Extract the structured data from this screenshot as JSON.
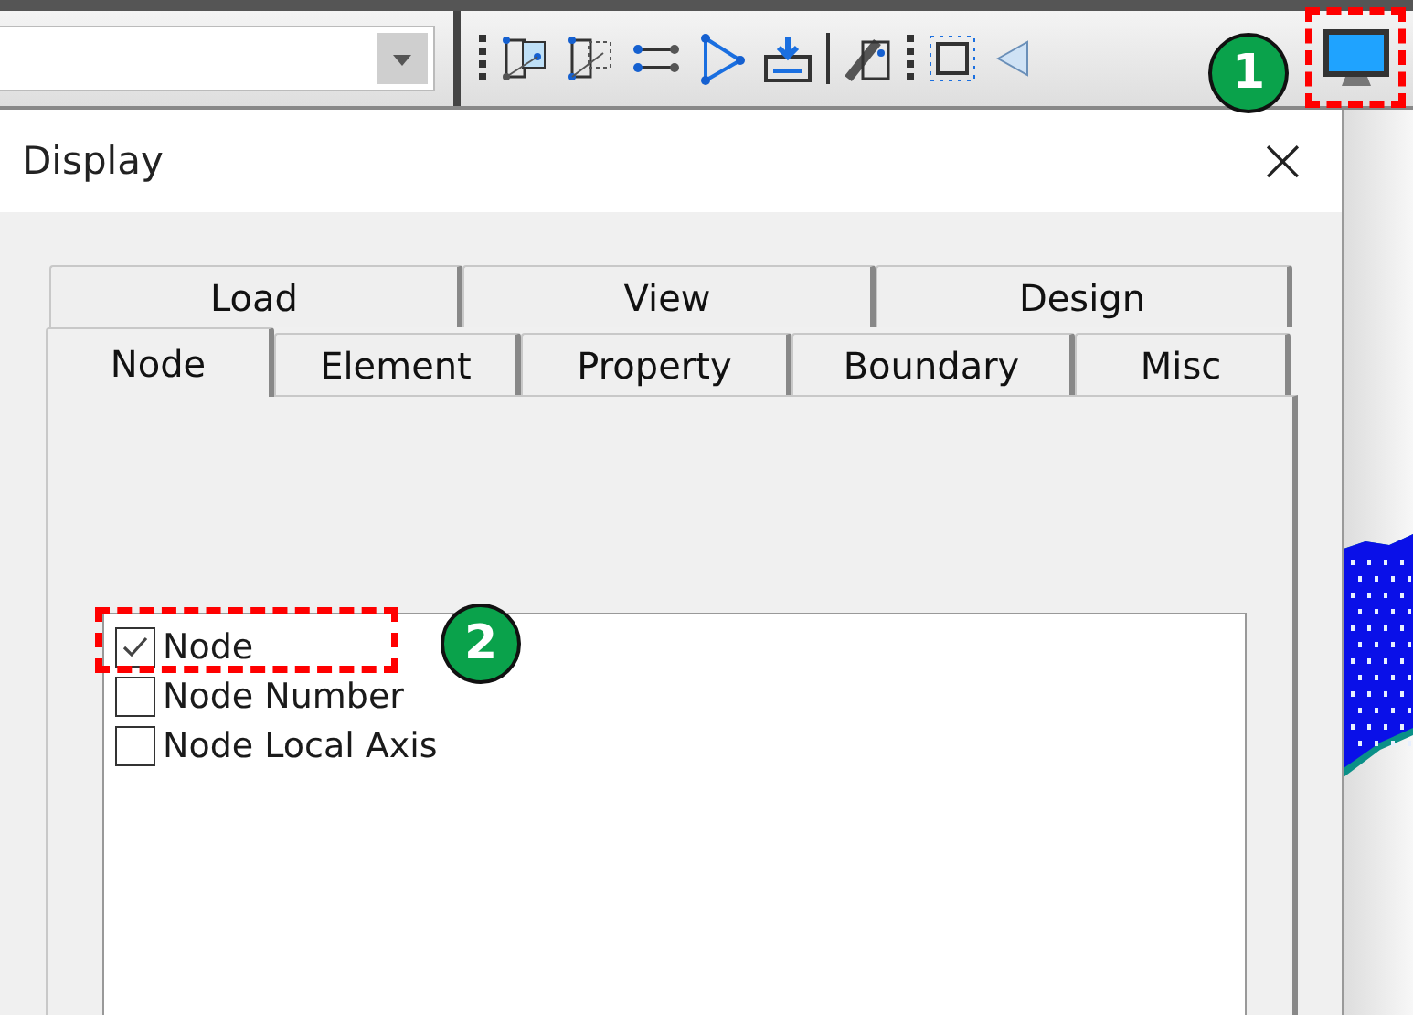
{
  "dialog": {
    "title": "Display",
    "close": "×"
  },
  "tab_rows": [
    [
      {
        "label": "Load",
        "selected": false
      },
      {
        "label": "View",
        "selected": false
      },
      {
        "label": "Design",
        "selected": false
      }
    ],
    [
      {
        "label": "Node",
        "selected": true
      },
      {
        "label": "Element",
        "selected": false
      },
      {
        "label": "Property",
        "selected": false
      },
      {
        "label": "Boundary",
        "selected": false
      },
      {
        "label": "Misc",
        "selected": false
      }
    ]
  ],
  "options": [
    {
      "label": "Node",
      "checked": true
    },
    {
      "label": "Node Number",
      "checked": false
    },
    {
      "label": "Node Local Axis",
      "checked": false
    }
  ],
  "annotations": [
    {
      "label": "1"
    },
    {
      "label": "2"
    }
  ]
}
